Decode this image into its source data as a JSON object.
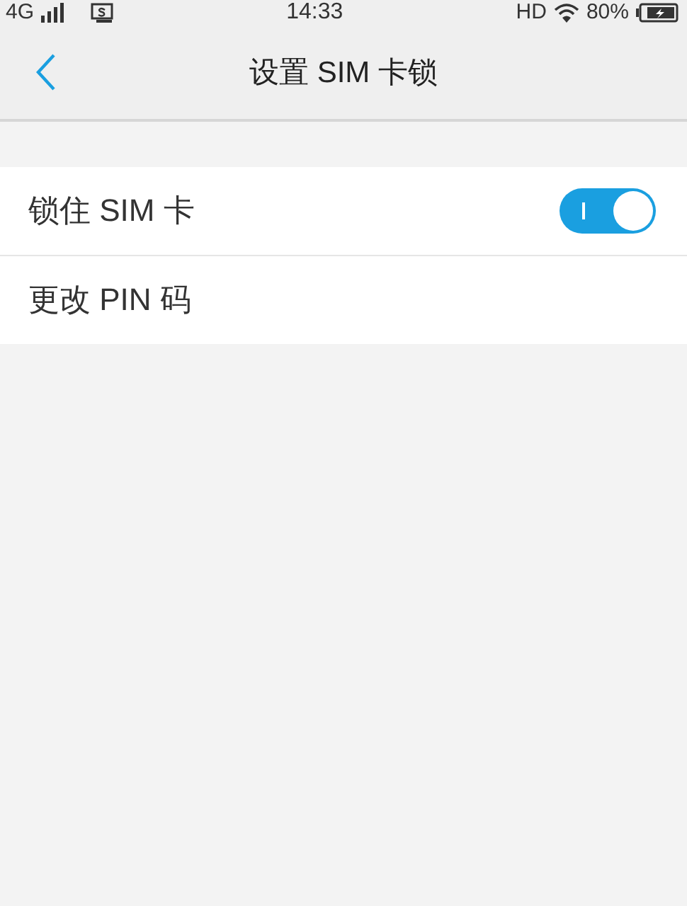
{
  "status_bar": {
    "network": "4G",
    "time": "14:33",
    "hd": "HD",
    "battery": "80%"
  },
  "nav_bar": {
    "title": "设置 SIM 卡锁"
  },
  "settings": [
    {
      "kind": "toggle",
      "label": "锁住 SIM 卡",
      "on": true
    },
    {
      "kind": "link",
      "label": "更改 PIN 码"
    }
  ]
}
